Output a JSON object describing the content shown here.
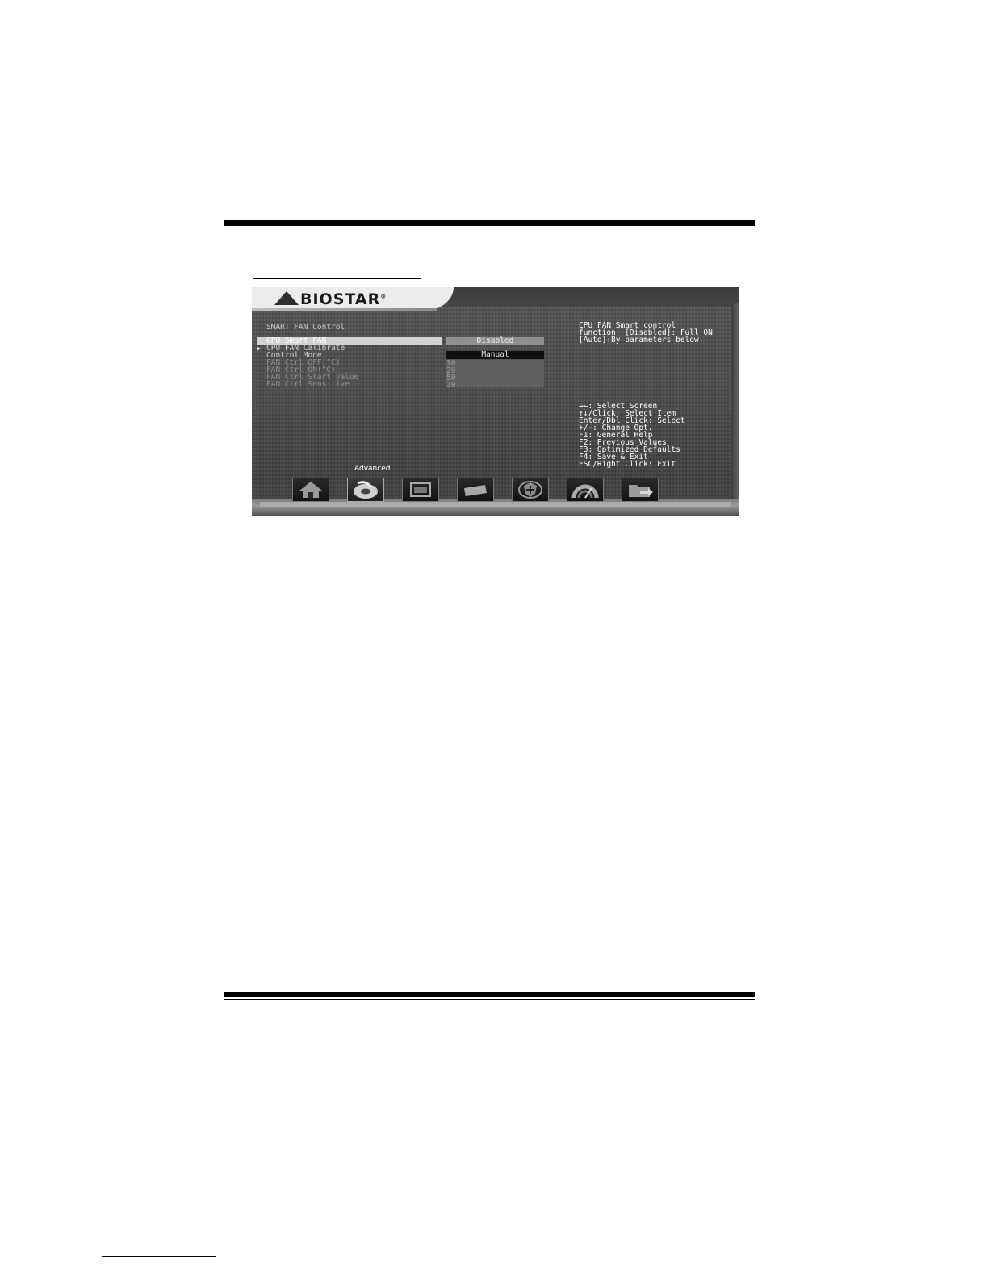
{
  "brand": {
    "logo_text": "BIOSTAR",
    "registered_mark": "®"
  },
  "menu": {
    "title": "SMART FAN Control",
    "items": [
      {
        "label": "CPU Smart FAN",
        "selected": true
      },
      {
        "label": "CPU FAN Calibrate",
        "submenu": true
      },
      {
        "label": "Control Mode"
      },
      {
        "label": "FAN Ctrl OFF(°C)",
        "dim": true
      },
      {
        "label": "FAN Ctrl ON(°C)",
        "dim": true
      },
      {
        "label": "FAN Ctrl Start Value",
        "dim": true
      },
      {
        "label": "FAN Ctrl Sensitive",
        "dim": true
      }
    ]
  },
  "values": {
    "cpu_smart_fan": "Disabled",
    "control_mode": "Manual",
    "fan_ctrl_off": "10",
    "fan_ctrl_on": "20",
    "fan_ctrl_start_value": "50",
    "fan_ctrl_sensitive": "30"
  },
  "help": {
    "lines": [
      "CPU FAN Smart control",
      "function. [Disabled]: Full ON",
      "[Auto]:By parameters below."
    ]
  },
  "keys": [
    "→←: Select Screen",
    "↑↓/Click: Select Item",
    "Enter/Dbl Click: Select",
    "+/-: Change Opt.",
    "F1: General Help",
    "F2: Previous Values",
    "F3: Optimized Defaults",
    "F4: Save & Exit",
    "ESC/Right Click: Exit"
  ],
  "nav": {
    "active_label": "Advanced",
    "icons": [
      "home-icon",
      "advanced-disc-icon",
      "chipset-icon",
      "boot-drive-icon",
      "security-shield-icon",
      "performance-gauge-icon",
      "save-exit-folder-icon"
    ]
  },
  "colors": {
    "bios_bg": "#4a4a4a",
    "selected_bar": "#d2d2d2",
    "manual_box": "#101010"
  }
}
